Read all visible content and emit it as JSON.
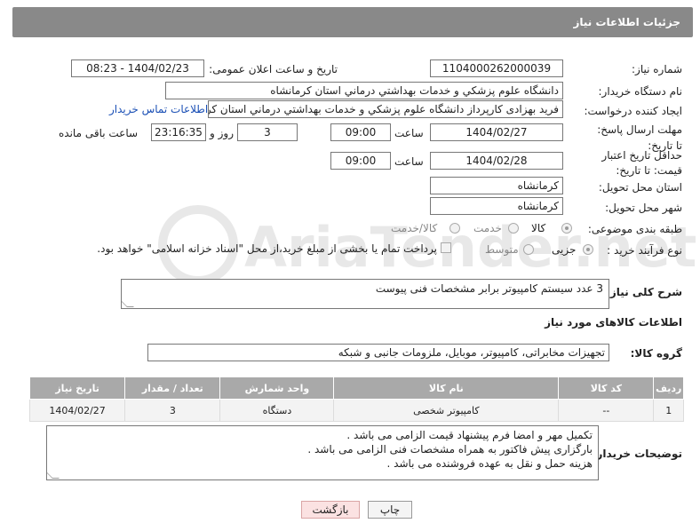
{
  "header": {
    "title": "جزئیات اطلاعات نیاز"
  },
  "fields": {
    "need_number_label": "شماره نیاز:",
    "need_number": "1104000262000039",
    "announce_label": "تاریخ و ساعت اعلان عمومی:",
    "announce_value": "1404/02/23 - 08:23",
    "buyer_label": "نام دستگاه خریدار:",
    "buyer_value": "دانشگاه علوم پزشکي و خدمات بهداشتي  درماني استان کرمانشاه",
    "creator_label": "ایجاد کننده درخواست:",
    "creator_value": "فرید  بهزادی کارپرداز دانشگاه علوم پزشکي و خدمات بهداشتي  درماني استان کرمانشاه",
    "contact_link": "اطلاعات تماس خریدار",
    "deadline_label": "مهلت ارسال پاسخ: تا تاریخ:",
    "deadline_date": "1404/02/27",
    "time_label": "ساعت",
    "deadline_time": "09:00",
    "days_value": "3",
    "days_label": "روز و",
    "remaining_value": "23:16:35",
    "remaining_label": "ساعت باقی مانده",
    "validity_label": "حداقل تاریخ اعتبار قیمت: تا تاریخ:",
    "validity_date": "1404/02/28",
    "validity_time": "09:00",
    "province_label": "استان محل تحویل:",
    "province_value": "کرمانشاه",
    "city_label": "شهر محل تحویل:",
    "city_value": "کرمانشاه",
    "category_label": "طبقه بندی موضوعی:",
    "category_options": [
      "کالا",
      "خدمت",
      "کالا/خدمت"
    ],
    "category_selected": "کالا",
    "process_label": "نوع فرآیند خرید :",
    "process_options": [
      "جزیی",
      "متوسط"
    ],
    "process_selected": "جزیی",
    "payment_text": "پرداخت تمام یا بخشی از مبلغ خرید،از محل \"اسناد خزانه اسلامی\" خواهد بود."
  },
  "description": {
    "label": "شرح کلی نیاز:",
    "value": "3  عدد سیستم کامپیوتر برابر مشخصات فنی پیوست"
  },
  "goods": {
    "section_title": "اطلاعات کالاهای مورد نیاز",
    "group_label": "گروه کالا:",
    "group_value": "تجهیزات مخابراتی، کامپیوتر، موبایل، ملزومات جانبی و شبکه",
    "columns": [
      "ردیف",
      "کد کالا",
      "نام کالا",
      "واحد شمارش",
      "تعداد / مقدار",
      "تاریخ نیاز"
    ],
    "rows": [
      [
        "1",
        "--",
        "کامپیوتر شخصی",
        "دستگاه",
        "3",
        "1404/02/27"
      ]
    ]
  },
  "buyer_notes": {
    "label": "توضیحات خریدار:",
    "lines": [
      "تکمیل مهر و امضا فرم پیشنهاد قیمت الزامی می باشد .",
      "بارگزاری پیش فاکتور به همراه مشخصات فنی  الزامی می باشد .",
      "هزینه حمل و نقل به عهده فروشنده می باشد ."
    ]
  },
  "buttons": {
    "print": "چاپ",
    "back": "بازگشت"
  },
  "watermark": {
    "text": "AriaTender.net",
    "icon": "aria-logo-icon"
  }
}
